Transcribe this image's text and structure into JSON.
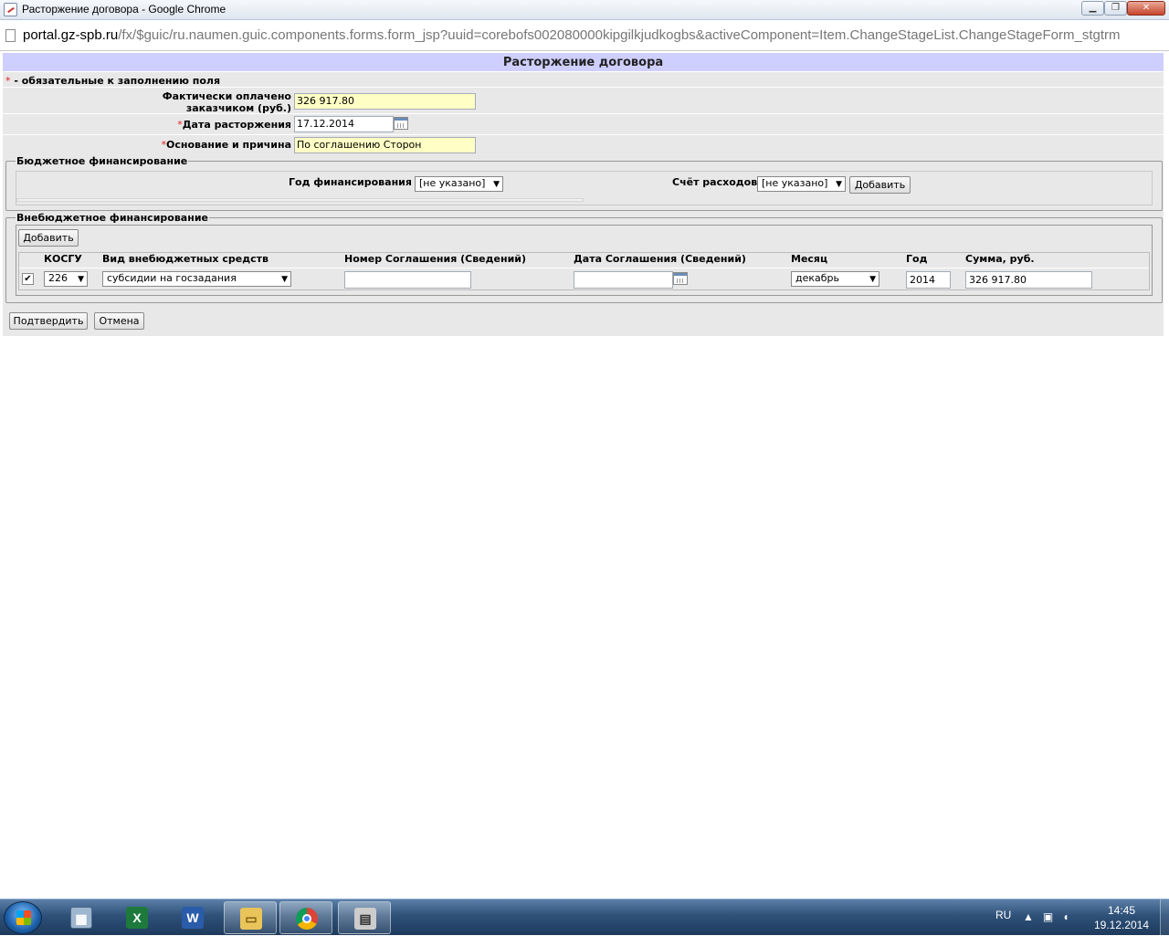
{
  "window": {
    "title": "Расторжение договора - Google Chrome",
    "min_label": "▁",
    "max_label": "❐",
    "close_label": "✕"
  },
  "address": {
    "host": "portal.gz-spb.ru",
    "path": "/fx/$guic/ru.naumen.guic.components.forms.form_jsp?uuid=corebofs002080000kipgilkjudkogbs&activeComponent=Item.ChangeStageList.ChangeStageForm_stgtrm"
  },
  "form": {
    "title": "Расторжение договора",
    "required_star": "*",
    "required_note": " - обязательные к заполнению поля",
    "fields": {
      "paid_label_line1": "Фактически оплачено",
      "paid_label_line2": "заказчиком (руб.)",
      "paid_value": "326 917.80",
      "termination_date_label": "Дата расторжения",
      "termination_date_value": "17.12.2014",
      "reason_label": "Основание и причина",
      "reason_value": "По соглашению Сторон"
    },
    "budget": {
      "legend": "Бюджетное финансирование",
      "year_label": "Год финансирования",
      "year_value": "[не указано]",
      "account_label": "Счёт расходов",
      "account_value": "[не указано]",
      "add_label": "Добавить"
    },
    "extra_budget": {
      "legend": "Внебюджетное финансирование",
      "add_label": "Добавить",
      "columns": [
        "КОСГУ",
        "Вид внебюджетных средств",
        "Номер Соглашения (Сведений)",
        "Дата Соглашения (Сведений)",
        "Месяц",
        "Год",
        "Сумма, руб."
      ],
      "row": {
        "checked": true,
        "kosgu": "226",
        "funds_type": "субсидии на госзадания",
        "agreement_number": "",
        "agreement_date": "",
        "month": "декабрь",
        "year": "2014",
        "amount": "326 917.80"
      }
    },
    "confirm_label": "Подтвердить",
    "cancel_label": "Отмена"
  },
  "taskbar": {
    "apps": [
      "calculator-icon",
      "excel-icon",
      "word-icon",
      "explorer-icon",
      "chrome-icon",
      "printer-icon"
    ],
    "lang": "RU",
    "time": "14:45",
    "date": "19.12.2014"
  }
}
